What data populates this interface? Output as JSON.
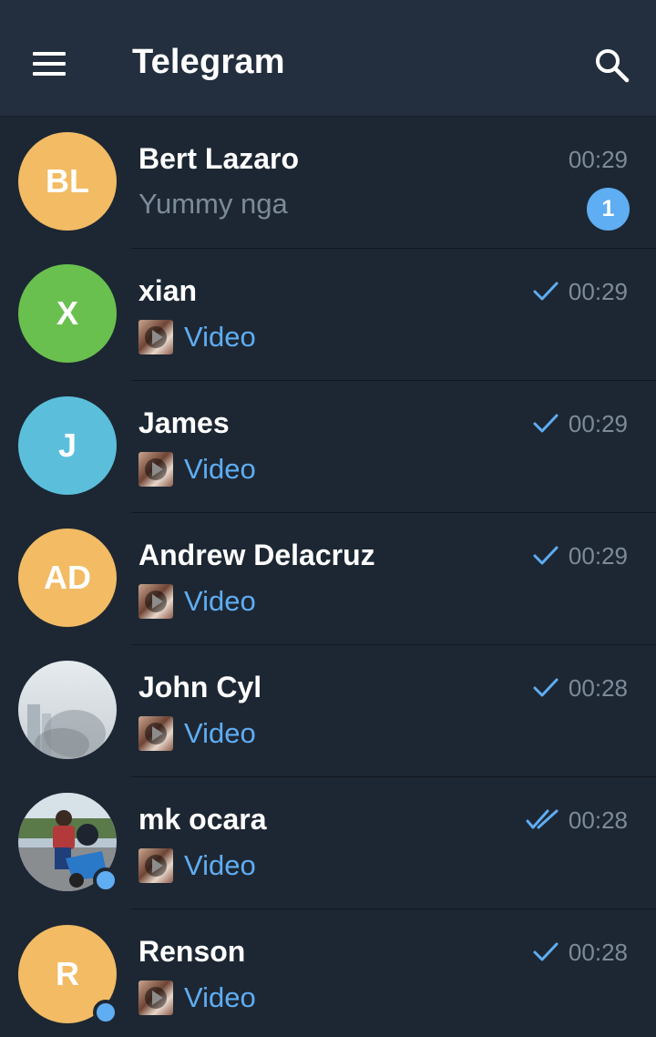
{
  "header": {
    "title": "Telegram",
    "menu_icon": "hamburger-menu-icon",
    "search_icon": "search-icon"
  },
  "colors": {
    "background": "#1d2733",
    "header": "#232f3e",
    "accent": "#5fadf2",
    "muted": "#7d8b99"
  },
  "chats": [
    {
      "name": "Bert Lazaro",
      "initials": "BL",
      "avatar_color": "#f2bb64",
      "time": "00:29",
      "preview": "Yummy nga",
      "preview_type": "text",
      "unread": "1",
      "status": "none",
      "online": false
    },
    {
      "name": "xian",
      "initials": "X",
      "avatar_color": "#6ac04f",
      "time": "00:29",
      "preview": "Video",
      "preview_type": "media",
      "unread": "",
      "status": "sent",
      "online": false
    },
    {
      "name": "James",
      "initials": "J",
      "avatar_color": "#5bbfdb",
      "time": "00:29",
      "preview": "Video",
      "preview_type": "media",
      "unread": "",
      "status": "sent",
      "online": false
    },
    {
      "name": "Andrew Delacruz",
      "initials": "AD",
      "avatar_color": "#f2bb64",
      "time": "00:29",
      "preview": "Video",
      "preview_type": "media",
      "unread": "",
      "status": "sent",
      "online": false
    },
    {
      "name": "John Cyl",
      "initials": "",
      "avatar_color": "",
      "avatar_photo": "hazy-sky-photo",
      "time": "00:28",
      "preview": "Video",
      "preview_type": "media",
      "unread": "",
      "status": "sent",
      "online": false
    },
    {
      "name": "mk ocara",
      "initials": "",
      "avatar_color": "",
      "avatar_photo": "person-on-motorbike-photo",
      "time": "00:28",
      "preview": "Video",
      "preview_type": "media",
      "unread": "",
      "status": "read",
      "online": true
    },
    {
      "name": "Renson",
      "initials": "R",
      "avatar_color": "#f2bb64",
      "time": "00:28",
      "preview": "Video",
      "preview_type": "media",
      "unread": "",
      "status": "sent",
      "online": true
    }
  ]
}
